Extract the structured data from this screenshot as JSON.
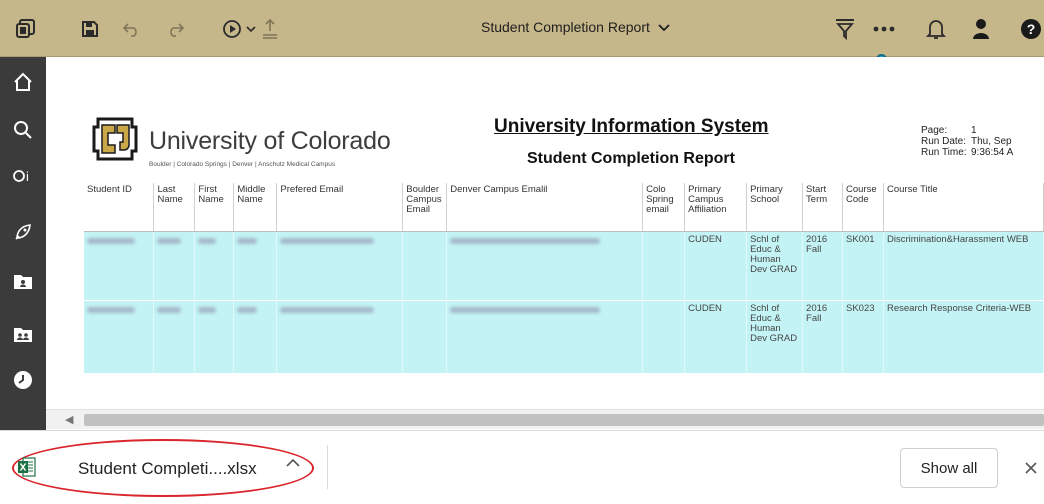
{
  "toolbar": {
    "report_title": "Student Completion Report"
  },
  "report": {
    "university": "University of Colorado",
    "campuses": "Boulder | Colorado Springs | Denver | Anschutz Medical Campus",
    "system_title": "University Information System",
    "report_title": "Student Completion Report",
    "meta": {
      "page_label": "Page:",
      "page_value": "1",
      "run_date_label": "Run Date:",
      "run_date_value": "Thu, Sep",
      "run_time_label": "Run Time:",
      "run_time_value": "9:36:54 A"
    },
    "columns": {
      "student_id": "Student ID",
      "last_name": "Last Name",
      "first_name": "First Name",
      "middle_name": "Middle Name",
      "preferred_email": "Prefered Email",
      "boulder_email": "Boulder Campus Email",
      "denver_email": "Denver Campus Emalil",
      "colo_spring_email": "Colo Spring email",
      "primary_campus": "Primary Campus Affiliation",
      "primary_school": "Primary School",
      "start_term": "Start Term",
      "course_code": "Course Code",
      "course_title": "Course Title"
    },
    "rows": [
      {
        "primary_campus": "CUDEN",
        "primary_school": "Schl of Educ & Human Dev GRAD",
        "start_term": "2016 Fall",
        "course_code": "SK001",
        "course_title": "Discrimination&Harassment WEB"
      },
      {
        "primary_campus": "CUDEN",
        "primary_school": "Schl of Educ & Human Dev GRAD",
        "start_term": "2016 Fall",
        "course_code": "SK023",
        "course_title": "Research Response Criteria-WEB"
      }
    ]
  },
  "download": {
    "file_name": "Student Completi....xlsx",
    "show_all": "Show all"
  },
  "colors": {
    "toolbar": "#c6b78a",
    "sidebar": "#3b3b3b",
    "row_highlight": "#c3f3f4",
    "annotation": "#d9252b",
    "excel": "#1e7145"
  }
}
